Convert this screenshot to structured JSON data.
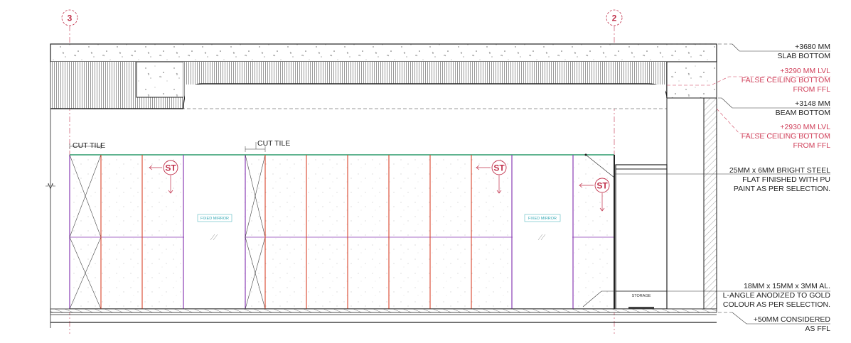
{
  "grid": {
    "left": "3",
    "right": "2"
  },
  "levels": {
    "slab": [
      "+3680 MM",
      "SLAB BOTTOM"
    ],
    "false_ceiling_1": [
      "+3290 MM LVL",
      "FALSE CEILING BOTTOM",
      "FROM FFL"
    ],
    "beam": [
      "+3148 MM",
      "BEAM BOTTOM"
    ],
    "false_ceiling_2": [
      "+2930 MM LVL",
      "FALSE CEILING BOTTOM",
      "FROM FFL"
    ]
  },
  "notes": {
    "steel_flat": [
      "25MM x 6MM BRIGHT STEEL",
      "FLAT FINISHED WITH PU",
      "PAINT AS PER SELECTION."
    ],
    "l_angle": [
      "18MM x 15MM x 3MM AL.",
      "L-ANGLE ANODIZED TO GOLD",
      "COLOUR AS PER SELECTION."
    ],
    "ffl": [
      "+50MM CONSIDERED",
      "AS FFL"
    ]
  },
  "labels": {
    "cut_tile_1": "CUT TILE",
    "cut_tile_2": "CUT TILE",
    "mirror_1": "FIXED MIRROR",
    "mirror_2": "FIXED MIRROR",
    "st_1": "ST",
    "st_2": "ST",
    "st_3": "ST",
    "storage": "STORAGE"
  },
  "colors": {
    "red_line": "#d9442b",
    "purple_line": "#8a3db5",
    "green_line": "#2a9a6a",
    "annotation_red": "#d0405a",
    "mirror_text": "#35a9b5"
  }
}
